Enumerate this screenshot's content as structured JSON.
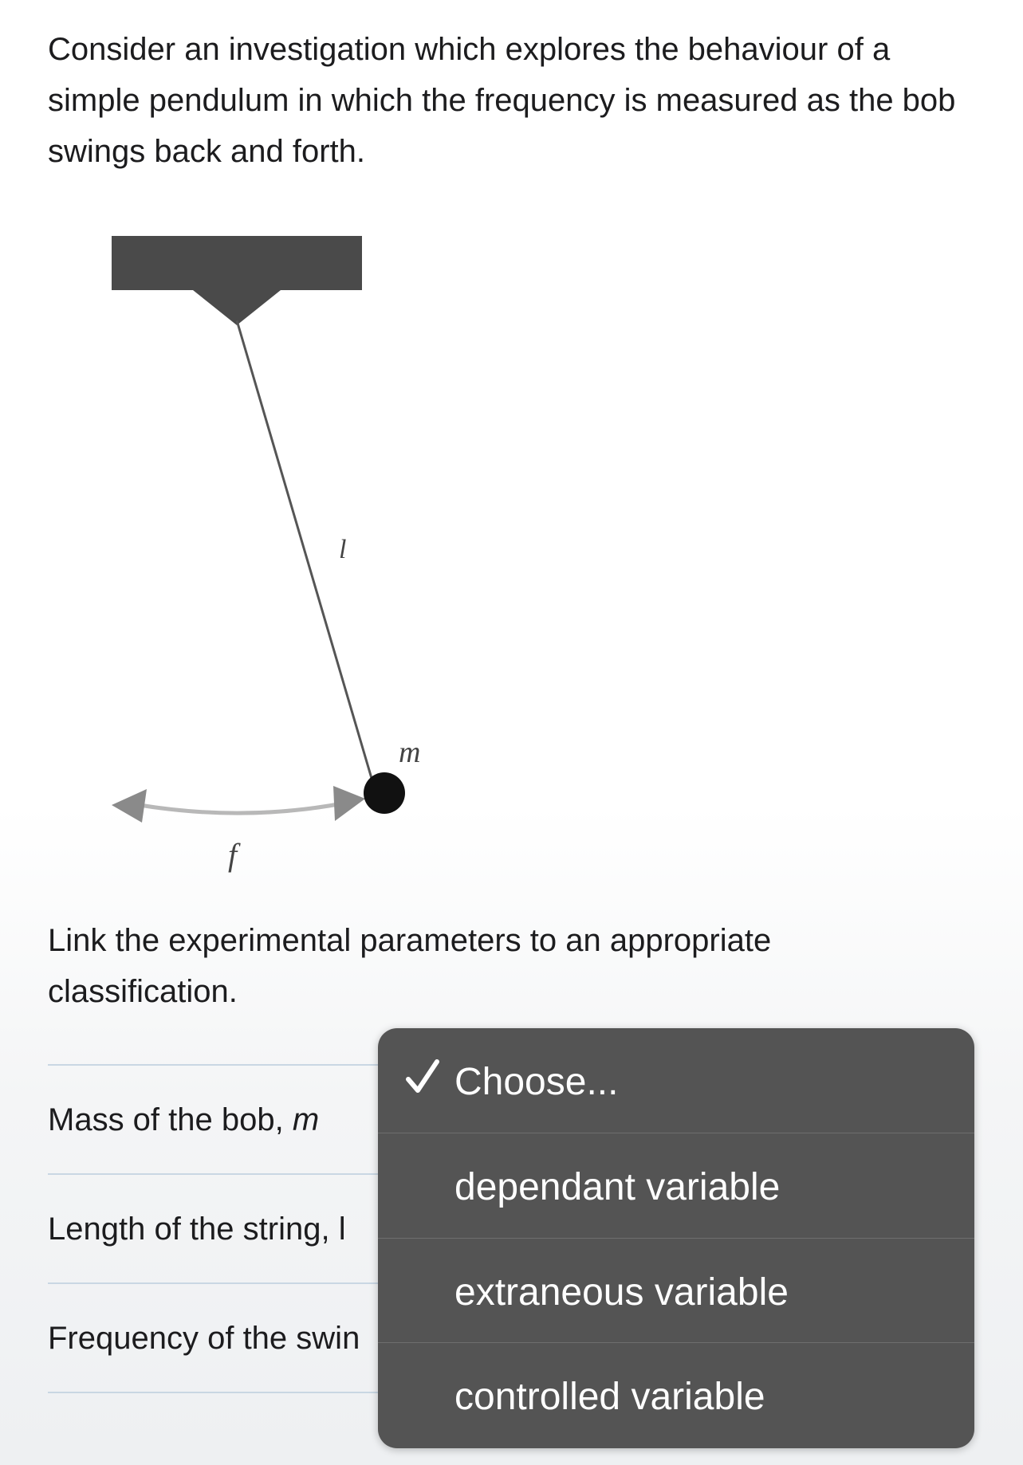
{
  "question": {
    "intro": "Consider an investigation which explores the behaviour of a simple pendulum in which the frequency is measured as the bob swings back and forth.",
    "prompt": "Link the experimental parameters to an appropriate classification."
  },
  "diagram": {
    "string_label": "l",
    "mass_label": "m",
    "frequency_label": "f"
  },
  "parameters": [
    {
      "label": "Mass of the bob, ",
      "symbol": "m"
    },
    {
      "label": "Length of the string, l",
      "symbol": ""
    },
    {
      "label": "Frequency of the swin",
      "symbol": ""
    }
  ],
  "dropdown": {
    "selected_check_icon": "checkmark-icon",
    "options": [
      {
        "label": "Choose...",
        "selected": true
      },
      {
        "label": "dependant variable",
        "selected": false
      },
      {
        "label": "extraneous variable",
        "selected": false
      },
      {
        "label": "controlled variable",
        "selected": false
      }
    ]
  },
  "colors": {
    "dropdown_bg": "#545454",
    "divider": "#c9d7e3",
    "diagram_dark": "#4a4a4a",
    "arrow_gray": "#8a8a8a"
  }
}
